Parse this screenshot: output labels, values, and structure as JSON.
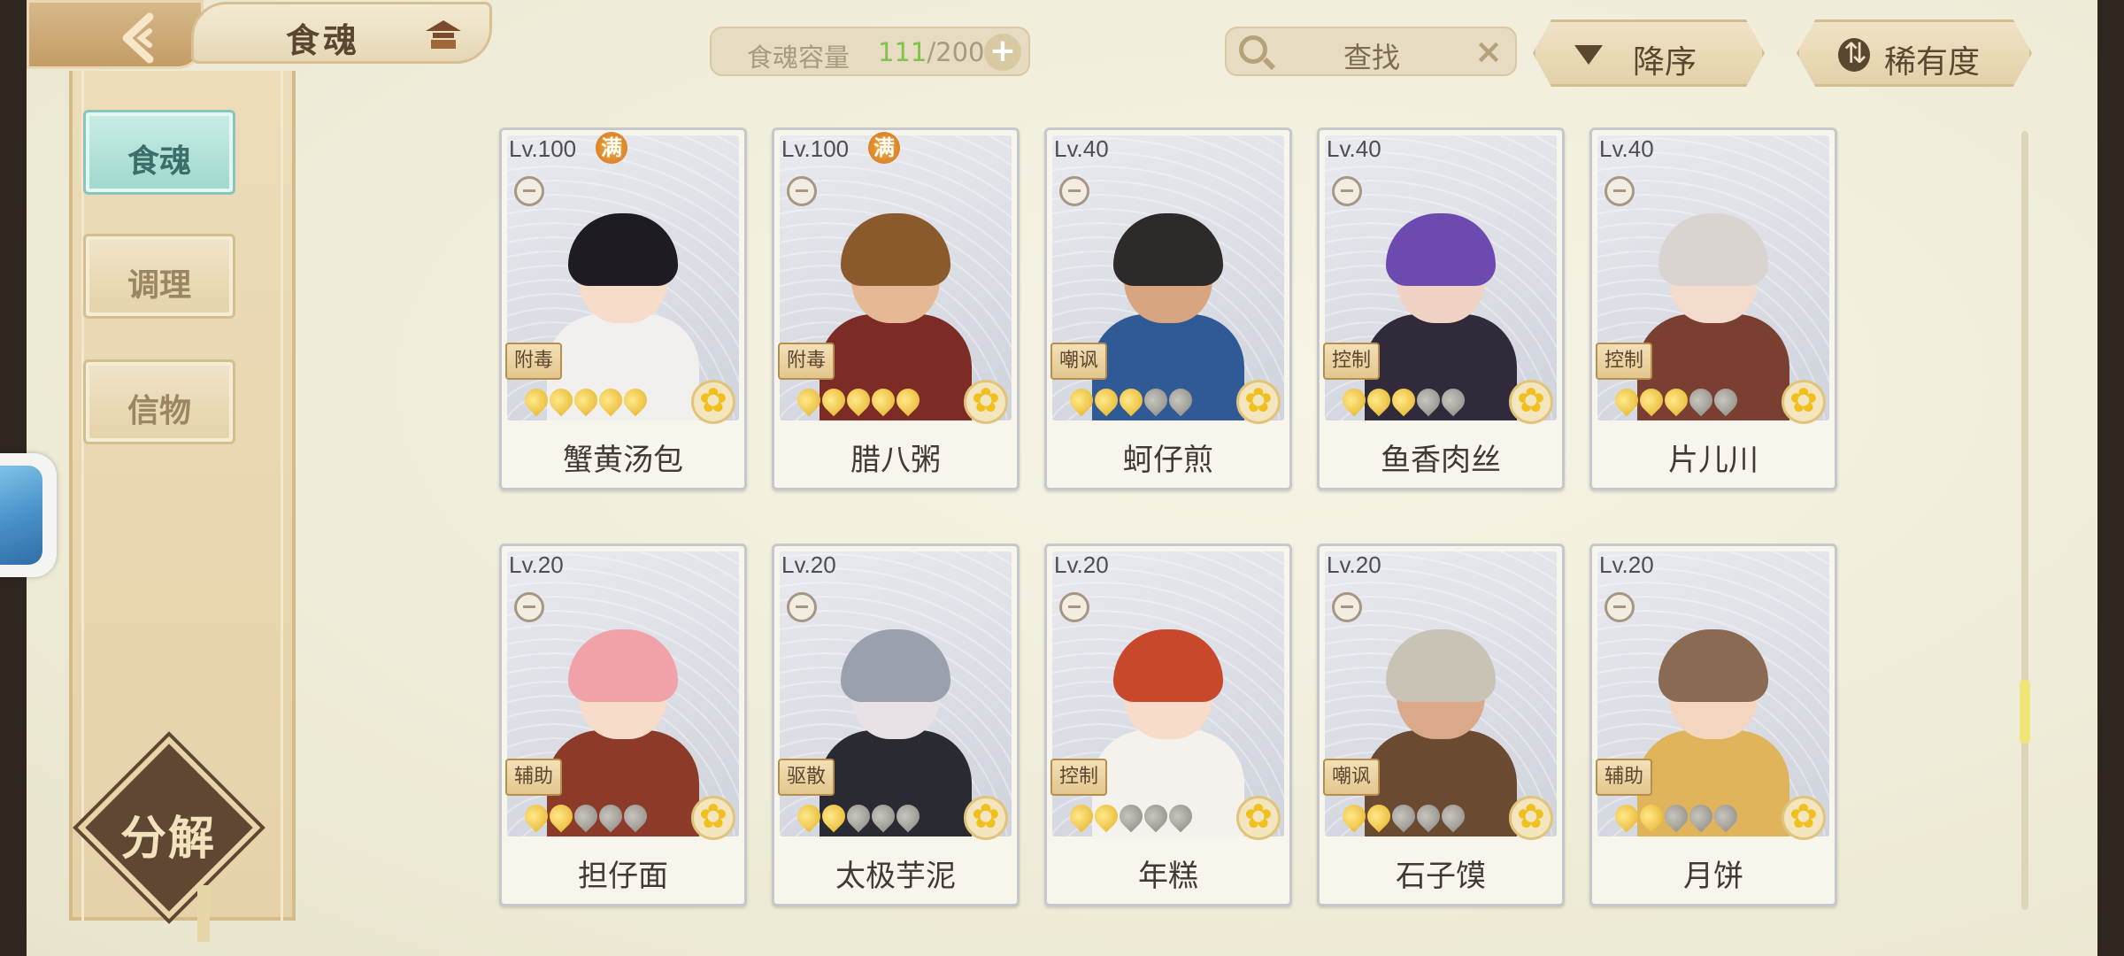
{
  "header": {
    "title": "食魂",
    "capacity_label": "食魂容量",
    "capacity_current": "111",
    "capacity_max": "/200",
    "capacity_add": "+",
    "search_placeholder": "查找",
    "search_clear": "×",
    "sort_order_label": "降序",
    "sort_key_label": "稀有度"
  },
  "sidebar": {
    "tabs": [
      {
        "label": "食魂",
        "active": true
      },
      {
        "label": "调理",
        "active": false
      },
      {
        "label": "信物",
        "active": false
      }
    ],
    "decompose_label": "分解"
  },
  "cards": [
    {
      "level": "Lv.100",
      "full": "满",
      "role": "附毒",
      "stars_on": 5,
      "stars_total": 5,
      "name": "蟹黄汤包",
      "hair": "#1e1c22",
      "skin": "#f6dcc9",
      "body": "#f2f0ee",
      "accent": "#e9a45c"
    },
    {
      "level": "Lv.100",
      "full": "满",
      "role": "附毒",
      "stars_on": 5,
      "stars_total": 5,
      "name": "腊八粥",
      "hair": "#8a5a2c",
      "skin": "#e6b994",
      "body": "#7d2b25",
      "accent": "#2a2a2a"
    },
    {
      "level": "Lv.40",
      "full": "",
      "role": "嘲讽",
      "stars_on": 3,
      "stars_total": 5,
      "name": "蚵仔煎",
      "hair": "#2f2a2a",
      "skin": "#d7a57f",
      "body": "#2f5a96",
      "accent": "#d94b3e"
    },
    {
      "level": "Lv.40",
      "full": "",
      "role": "控制",
      "stars_on": 3,
      "stars_total": 5,
      "name": "鱼香肉丝",
      "hair": "#6c4ab0",
      "skin": "#f0d3c3",
      "body": "#302a3a",
      "accent": "#b23a3a"
    },
    {
      "level": "Lv.40",
      "full": "",
      "role": "控制",
      "stars_on": 3,
      "stars_total": 5,
      "name": "片儿川",
      "hair": "#d9d4cf",
      "skin": "#f3dccb",
      "body": "#7a3f30",
      "accent": "#f1efe9"
    },
    {
      "level": "Lv.20",
      "full": "",
      "role": "辅助",
      "stars_on": 2,
      "stars_total": 5,
      "name": "担仔面",
      "hair": "#f0a2a8",
      "skin": "#f6dcc9",
      "body": "#8c3b28",
      "accent": "#4a2c2a"
    },
    {
      "level": "Lv.20",
      "full": "",
      "role": "驱散",
      "stars_on": 2,
      "stars_total": 5,
      "name": "太极芋泥",
      "hair": "#9aa0ae",
      "skin": "#e8e2e6",
      "body": "#2a2a33",
      "accent": "#8a62c8"
    },
    {
      "level": "Lv.20",
      "full": "",
      "role": "控制",
      "stars_on": 2,
      "stars_total": 5,
      "name": "年糕",
      "hair": "#c8482c",
      "skin": "#f6dcc9",
      "body": "#f5f2ee",
      "accent": "#d43a2c"
    },
    {
      "level": "Lv.20",
      "full": "",
      "role": "嘲讽",
      "stars_on": 2,
      "stars_total": 5,
      "name": "石子馍",
      "hair": "#c9c3b6",
      "skin": "#d9a98a",
      "body": "#6a4a30",
      "accent": "#e7d6c4"
    },
    {
      "level": "Lv.20",
      "full": "",
      "role": "辅助",
      "stars_on": 2,
      "stars_total": 5,
      "name": "月饼",
      "hair": "#8a6a52",
      "skin": "#f3d6c0",
      "body": "#e0b45a",
      "accent": "#c3342a"
    }
  ]
}
